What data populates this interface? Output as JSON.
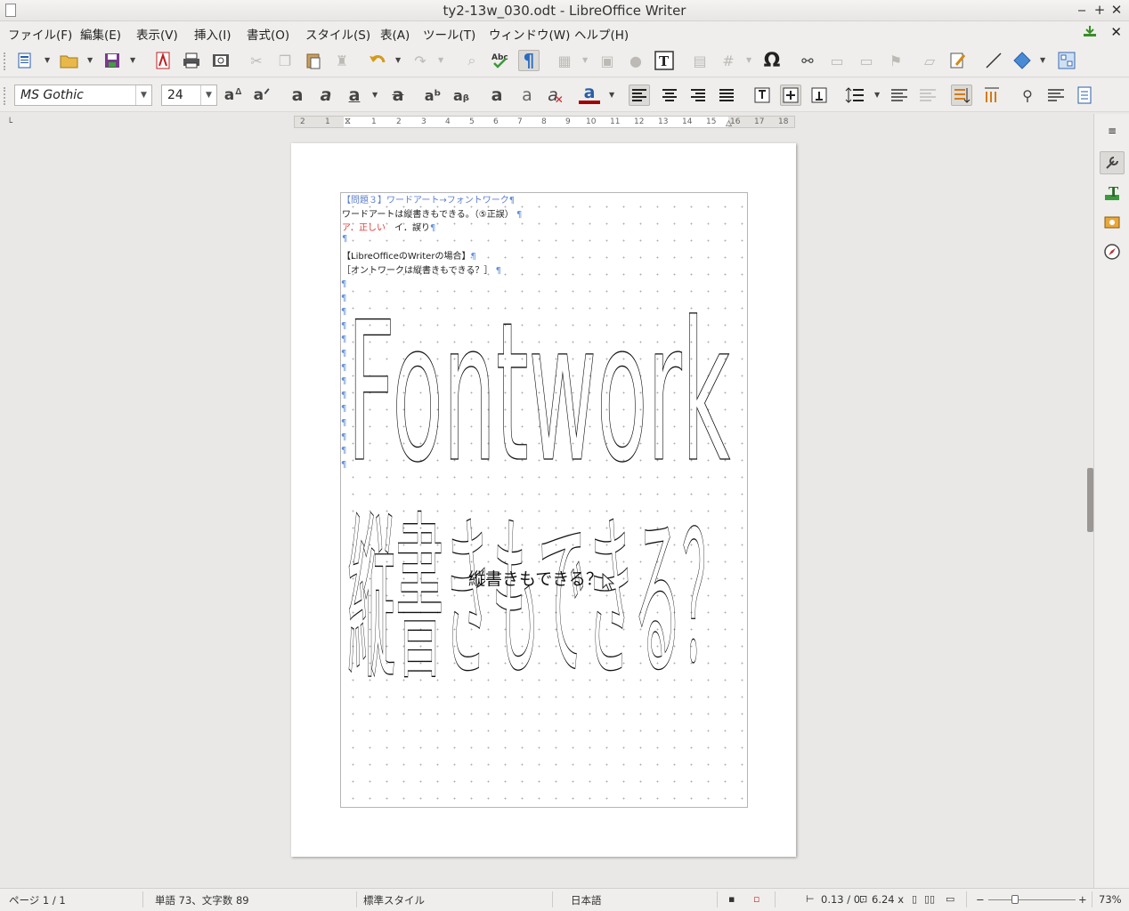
{
  "window": {
    "title": "ty2-13w_030.odt - LibreOffice Writer",
    "minimize": "‒",
    "maximize": "+",
    "close": "✕"
  },
  "menu": [
    "ファイル(F)",
    "編集(E)",
    "表示(V)",
    "挿入(I)",
    "書式(O)",
    "スタイル(S)",
    "表(A)",
    "ツール(T)",
    "ウィンドウ(W)",
    "ヘルプ(H)"
  ],
  "formatting": {
    "font_name": "MS Gothic",
    "font_size": "24"
  },
  "ruler": {
    "ticks": [
      "2",
      "1",
      "1",
      "2",
      "3",
      "4",
      "5",
      "6",
      "7",
      "8",
      "9",
      "10",
      "11",
      "12",
      "13",
      "14",
      "15",
      "16",
      "17",
      "18"
    ]
  },
  "document": {
    "line1": "【問題３】ワードアート→フォントワーク",
    "line2": "ワードアートは縦書きもできる。（⑤正誤）",
    "line3a": "ア．正しい",
    "line3b": "イ．誤り",
    "line5": "【LibreOfficeのWriterの場合】",
    "line6": "［オントワークは縦書きもできる？］",
    "pilcrow": "¶",
    "fontwork_line1": "Fontwork",
    "fontwork_line2": "縦書きもできる？",
    "fontwork_center_text": "縦書きもできる？"
  },
  "status": {
    "page": "ページ 1 / 1",
    "words": "単語 73、文字数 89",
    "style": "標準スタイル",
    "language": "日本語",
    "position": "0.13 / 0.",
    "size": "6.24 x",
    "zoom_minus": "−",
    "zoom_plus": "+",
    "zoom": "73%"
  },
  "colors": {
    "accent_blue": "#5f7fd0",
    "answer_red": "#e03a3a",
    "pilcrow_blue": "#5f8fd8"
  },
  "icons": {
    "toolbar1": [
      "new-document-icon",
      "open-icon",
      "save-icon",
      "export-pdf-icon",
      "print-icon",
      "print-preview-icon",
      "cut-icon",
      "copy-icon",
      "paste-icon",
      "clone-formatting-icon",
      "undo-icon",
      "redo-icon",
      "find-replace-icon",
      "spelling-icon",
      "formatting-marks-icon",
      "insert-table-icon",
      "insert-image-icon",
      "insert-chart-icon",
      "insert-textbox-icon",
      "page-break-icon",
      "insert-field-icon",
      "special-character-icon",
      "hyperlink-icon",
      "footnote-icon",
      "endnote-icon",
      "bookmark-icon",
      "comment-icon",
      "track-changes-icon",
      "line-icon",
      "basic-shapes-icon",
      "draw-functions-icon"
    ],
    "toolbar2": [
      "superscript-icon",
      "subscript-icon",
      "bold-icon",
      "italic-icon",
      "underline-icon",
      "strikethrough-icon",
      "increase-font-icon",
      "decrease-font-icon",
      "shadow-icon",
      "outline-icon",
      "clear-formatting-icon",
      "font-color-icon",
      "align-left-icon",
      "align-center-icon",
      "align-right-icon",
      "justify-icon",
      "align-top-icon",
      "align-middle-icon",
      "align-bottom-icon",
      "line-spacing-icon",
      "increase-spacing-icon",
      "decrease-spacing-icon",
      "text-direction-ltr-icon",
      "text-direction-ttb-icon",
      "paragraph-icon",
      "character-icon",
      "page-icon"
    ],
    "sidebar": [
      "sidebar-menu-icon",
      "properties-icon",
      "styles-icon",
      "gallery-icon",
      "navigator-icon"
    ]
  }
}
